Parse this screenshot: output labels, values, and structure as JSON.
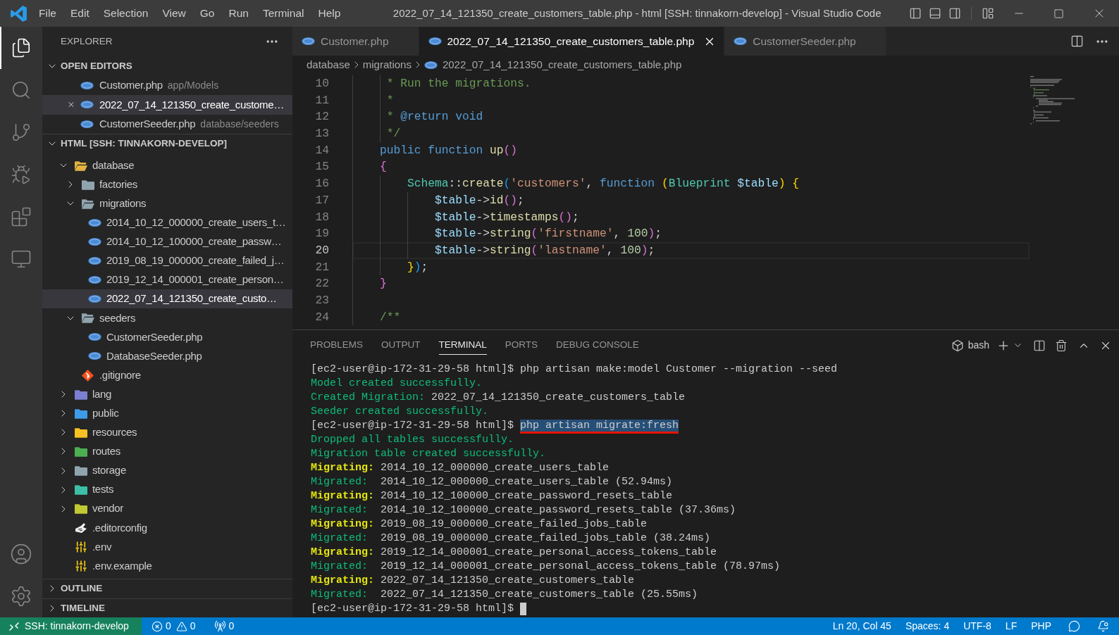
{
  "title_bar": {
    "menu": [
      "File",
      "Edit",
      "Selection",
      "View",
      "Go",
      "Run",
      "Terminal",
      "Help"
    ],
    "title": "2022_07_14_121350_create_customers_table.php - html [SSH: tinnakorn-develop] - Visual Studio Code"
  },
  "activity_bar": {
    "items": [
      {
        "kind": "explorer",
        "selected": true
      },
      {
        "kind": "search",
        "selected": false
      },
      {
        "kind": "source_control",
        "selected": false
      },
      {
        "kind": "debug",
        "selected": false
      },
      {
        "kind": "extensions",
        "selected": false
      },
      {
        "kind": "remote",
        "selected": false
      }
    ]
  },
  "sidebar": {
    "title": "EXPLORER",
    "open_editors": {
      "title": "OPEN EDITORS",
      "expanded": true,
      "items": [
        {
          "name": "Customer.php",
          "path": "app/Models",
          "selected": false
        },
        {
          "name": "2022_07_14_121350_create_custome…",
          "selected": true
        },
        {
          "name": "CustomerSeeder.php",
          "path": "database/seeders",
          "selected": false
        }
      ]
    },
    "workspace": {
      "title": "HTML [SSH: TINNAKORN-DEVELOP]",
      "expanded": true,
      "tree": [
        {
          "name": "database",
          "kind": "folder",
          "color": "#e2b340",
          "expanded": true,
          "selected": false,
          "children": [
            {
              "name": "factories",
              "kind": "folder",
              "color": "#90a4ae",
              "expanded": false,
              "selected": false
            },
            {
              "name": "migrations",
              "kind": "folder",
              "color": "#90a4ae",
              "expanded": true,
              "selected": false,
              "children": [
                {
                  "name": "2014_10_12_000000_create_users_t…",
                  "kind": "php",
                  "selected": false
                },
                {
                  "name": "2014_10_12_100000_create_passw…",
                  "kind": "php",
                  "selected": false
                },
                {
                  "name": "2019_08_19_000000_create_failed_j…",
                  "kind": "php",
                  "selected": false
                },
                {
                  "name": "2019_12_14_000001_create_person…",
                  "kind": "php",
                  "selected": false
                },
                {
                  "name": "2022_07_14_121350_create_custo…",
                  "kind": "php",
                  "selected": true
                }
              ]
            },
            {
              "name": "seeders",
              "kind": "folder",
              "color": "#90a4ae",
              "expanded": true,
              "selected": false,
              "children": [
                {
                  "name": "CustomerSeeder.php",
                  "kind": "php",
                  "selected": false
                },
                {
                  "name": "DatabaseSeeder.php",
                  "kind": "php",
                  "selected": false
                }
              ]
            },
            {
              "name": ".gitignore",
              "kind": "git",
              "selected": false
            }
          ]
        },
        {
          "name": "lang",
          "kind": "folder",
          "color": "#7b7fd1",
          "expanded": false,
          "selected": false
        },
        {
          "name": "public",
          "kind": "folder",
          "color": "#3d9be9",
          "expanded": false,
          "selected": false
        },
        {
          "name": "resources",
          "kind": "folder",
          "color": "#f6c221",
          "expanded": false,
          "selected": false
        },
        {
          "name": "routes",
          "kind": "folder",
          "color": "#4caf50",
          "expanded": false,
          "selected": false
        },
        {
          "name": "storage",
          "kind": "folder",
          "color": "#90a4ae",
          "expanded": false,
          "selected": false
        },
        {
          "name": "tests",
          "kind": "folder",
          "color": "#3cbfa6",
          "expanded": false,
          "selected": false
        },
        {
          "name": "vendor",
          "kind": "folder",
          "color": "#c0ca33",
          "expanded": false,
          "selected": false
        },
        {
          "name": ".editorconfig",
          "kind": "config",
          "selected": false
        },
        {
          "name": ".env",
          "kind": "env",
          "selected": false
        },
        {
          "name": ".env.example",
          "kind": "env",
          "selected": false
        }
      ]
    },
    "sections": [
      {
        "title": "OUTLINE",
        "expanded": false
      },
      {
        "title": "TIMELINE",
        "expanded": false
      }
    ]
  },
  "editor": {
    "tabs": [
      {
        "name": "Customer.php",
        "selected": false
      },
      {
        "name": "2022_07_14_121350_create_customers_table.php",
        "selected": true
      },
      {
        "name": "CustomerSeeder.php",
        "selected": false
      }
    ],
    "breadcrumbs": [
      "database",
      "migrations",
      "2022_07_14_121350_create_customers_table.php"
    ],
    "lines": [
      {
        "number": "10",
        "current": false,
        "tokens": [
          {
            "kind": "comment",
            "text": "     * Run the migrations."
          }
        ]
      },
      {
        "number": "11",
        "current": false,
        "tokens": [
          {
            "kind": "comment",
            "text": "     *"
          }
        ]
      },
      {
        "number": "12",
        "current": false,
        "tokens": [
          {
            "kind": "comment",
            "text": "     * "
          },
          {
            "kind": "doc",
            "text": "@return void"
          }
        ]
      },
      {
        "number": "13",
        "current": false,
        "tokens": [
          {
            "kind": "comment",
            "text": "     */"
          }
        ]
      },
      {
        "number": "14",
        "current": false,
        "tokens": [
          {
            "kind": "keyword",
            "text": "    public function "
          },
          {
            "kind": "function",
            "text": "up"
          },
          {
            "kind": "bracket2",
            "text": "()"
          }
        ]
      },
      {
        "number": "15",
        "current": false,
        "tokens": [
          {
            "kind": "bracket2",
            "text": "    {"
          }
        ]
      },
      {
        "number": "16",
        "current": false,
        "tokens": [
          {
            "kind": "class",
            "text": "        Schema"
          },
          {
            "kind": "plain",
            "text": "::"
          },
          {
            "kind": "function",
            "text": "create"
          },
          {
            "kind": "bracket3",
            "text": "("
          },
          {
            "kind": "string",
            "text": "'customers'"
          },
          {
            "kind": "plain",
            "text": ", "
          },
          {
            "kind": "keyword",
            "text": "function "
          },
          {
            "kind": "bracket1",
            "text": "("
          },
          {
            "kind": "class",
            "text": "Blueprint "
          },
          {
            "kind": "variable",
            "text": "$table"
          },
          {
            "kind": "bracket1",
            "text": ") {"
          }
        ]
      },
      {
        "number": "17",
        "current": false,
        "tokens": [
          {
            "kind": "variable",
            "text": "            $table"
          },
          {
            "kind": "plain",
            "text": "->"
          },
          {
            "kind": "function",
            "text": "id"
          },
          {
            "kind": "bracket2",
            "text": "()"
          },
          {
            "kind": "plain",
            "text": ";"
          }
        ]
      },
      {
        "number": "18",
        "current": false,
        "tokens": [
          {
            "kind": "variable",
            "text": "            $table"
          },
          {
            "kind": "plain",
            "text": "->"
          },
          {
            "kind": "function",
            "text": "timestamps"
          },
          {
            "kind": "bracket2",
            "text": "()"
          },
          {
            "kind": "plain",
            "text": ";"
          }
        ]
      },
      {
        "number": "19",
        "current": false,
        "tokens": [
          {
            "kind": "variable",
            "text": "            $table"
          },
          {
            "kind": "plain",
            "text": "->"
          },
          {
            "kind": "function",
            "text": "string"
          },
          {
            "kind": "bracket2",
            "text": "("
          },
          {
            "kind": "string",
            "text": "'firstname'"
          },
          {
            "kind": "plain",
            "text": ", "
          },
          {
            "kind": "number",
            "text": "100"
          },
          {
            "kind": "bracket2",
            "text": ")"
          },
          {
            "kind": "plain",
            "text": ";"
          }
        ]
      },
      {
        "number": "20",
        "current": true,
        "tokens": [
          {
            "kind": "variable",
            "text": "            $table"
          },
          {
            "kind": "plain",
            "text": "->"
          },
          {
            "kind": "function",
            "text": "string"
          },
          {
            "kind": "bracket2",
            "text": "("
          },
          {
            "kind": "string",
            "text": "'lastname'"
          },
          {
            "kind": "plain",
            "text": ", "
          },
          {
            "kind": "number",
            "text": "100"
          },
          {
            "kind": "bracket2",
            "text": ")"
          },
          {
            "kind": "plain",
            "text": ";"
          }
        ]
      },
      {
        "number": "21",
        "current": false,
        "tokens": [
          {
            "kind": "bracket1",
            "text": "        }"
          },
          {
            "kind": "bracket3",
            "text": ")"
          },
          {
            "kind": "plain",
            "text": ";"
          }
        ]
      },
      {
        "number": "22",
        "current": false,
        "tokens": [
          {
            "kind": "bracket2",
            "text": "    }"
          }
        ]
      },
      {
        "number": "23",
        "current": false
      },
      {
        "number": "24",
        "current": false,
        "tokens": [
          {
            "kind": "comment",
            "text": "    /**"
          }
        ]
      }
    ]
  },
  "panel": {
    "tabs": [
      {
        "label": "PROBLEMS",
        "selected": false
      },
      {
        "label": "OUTPUT",
        "selected": false
      },
      {
        "label": "TERMINAL",
        "selected": true
      },
      {
        "label": "PORTS",
        "selected": false
      },
      {
        "label": "DEBUG CONSOLE",
        "selected": false
      }
    ],
    "terminal_name": "bash",
    "lines": [
      {
        "kind": "command",
        "prompt": "[ec2-user@ip-172-31-29-58 html]$",
        "command": "php artisan make:model Customer --migration --seed",
        "selected": false,
        "underlined": false
      },
      {
        "kind": "success",
        "text": "Model created successfully."
      },
      {
        "kind": "info",
        "label": "Created Migration:",
        "text": "2022_07_14_121350_create_customers_table"
      },
      {
        "kind": "success",
        "text": "Seeder created successfully."
      },
      {
        "kind": "command",
        "prompt": "[ec2-user@ip-172-31-29-58 html]$",
        "command": "php artisan migrate:fresh",
        "selected": true,
        "underlined": true
      },
      {
        "kind": "success",
        "text": "Dropped all tables successfully."
      },
      {
        "kind": "success",
        "text": "Migration table created successfully."
      },
      {
        "kind": "migrating",
        "label": "Migrating:",
        "text": "2014_10_12_000000_create_users_table"
      },
      {
        "kind": "migrated",
        "label": "Migrated:",
        "text": "2014_10_12_000000_create_users_table (52.94ms)"
      },
      {
        "kind": "migrating",
        "label": "Migrating:",
        "text": "2014_10_12_100000_create_password_resets_table"
      },
      {
        "kind": "migrated",
        "label": "Migrated:",
        "text": "2014_10_12_100000_create_password_resets_table (37.36ms)"
      },
      {
        "kind": "migrating",
        "label": "Migrating:",
        "text": "2019_08_19_000000_create_failed_jobs_table"
      },
      {
        "kind": "migrated",
        "label": "Migrated:",
        "text": "2019_08_19_000000_create_failed_jobs_table (38.24ms)"
      },
      {
        "kind": "migrating",
        "label": "Migrating:",
        "text": "2019_12_14_000001_create_personal_access_tokens_table"
      },
      {
        "kind": "migrated",
        "label": "Migrated:",
        "text": "2019_12_14_000001_create_personal_access_tokens_table (78.97ms)"
      },
      {
        "kind": "migrating",
        "label": "Migrating:",
        "text": "2022_07_14_121350_create_customers_table"
      },
      {
        "kind": "migrated",
        "label": "Migrated:",
        "text": "2022_07_14_121350_create_customers_table (25.55ms)"
      },
      {
        "kind": "input",
        "prompt": "[ec2-user@ip-172-31-29-58 html]$"
      }
    ]
  },
  "status_bar": {
    "remote": "SSH: tinnakorn-develop",
    "errors": "0",
    "warnings": "0",
    "ports": "0",
    "items": [
      "Ln 20, Col 45",
      "Spaces: 4",
      "UTF-8",
      "LF",
      "PHP"
    ]
  }
}
